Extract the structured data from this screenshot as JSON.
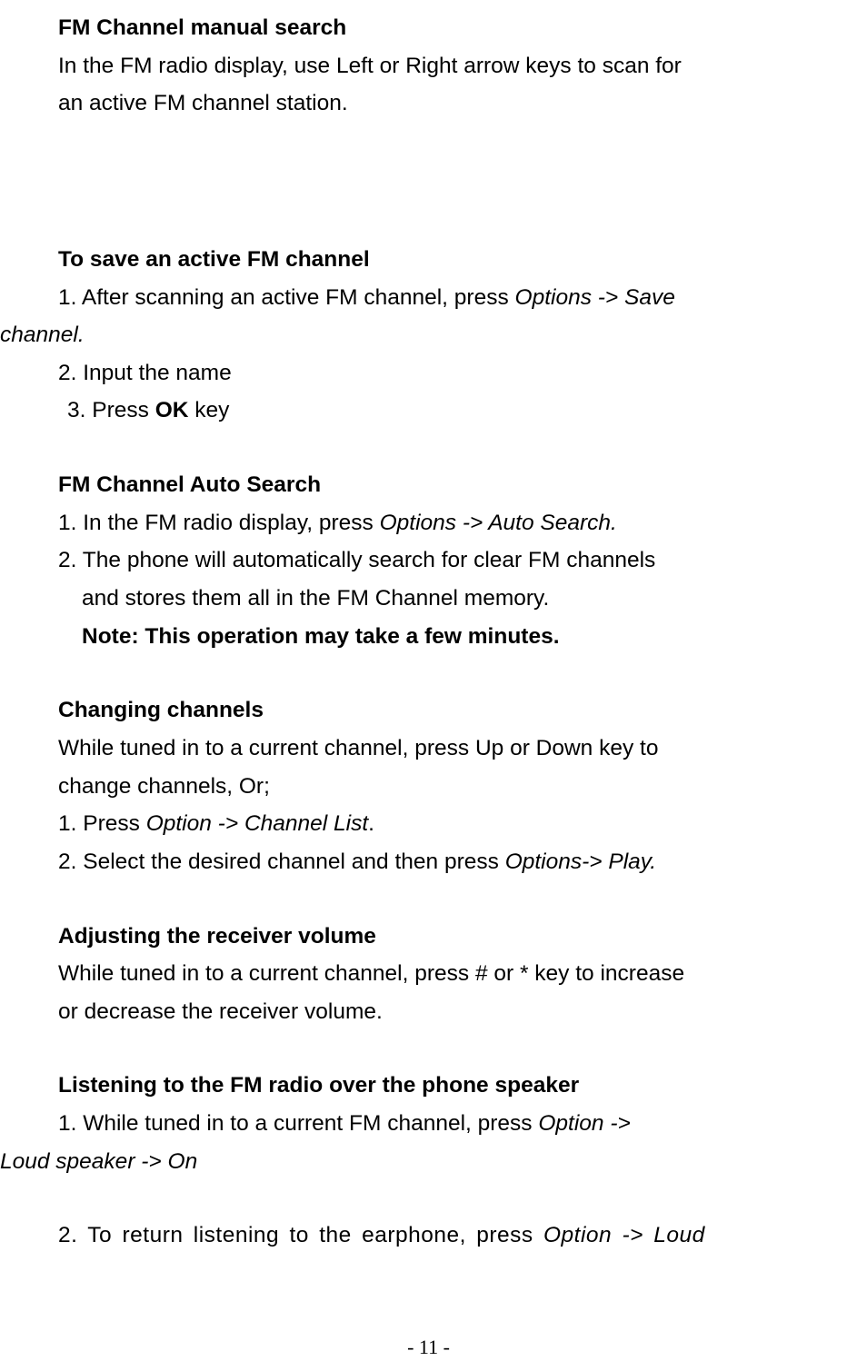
{
  "s1": {
    "title": "FM Channel manual search",
    "line1": "In the FM radio display, use Left or Right arrow keys to scan for",
    "line2": "an active FM channel station."
  },
  "s2": {
    "title": "To save an active FM channel",
    "line1a": "1. After scanning an active FM channel, press ",
    "line1b": "Options -> Save",
    "line1c": "channel.",
    "line2": "2. Input the name",
    "line3a": "3. Press ",
    "line3b": "OK",
    "line3c": " key"
  },
  "s3": {
    "title": "FM Channel Auto Search",
    "line1a": "1. In the FM radio display, press ",
    "line1b": "Options -> Auto Search.",
    "line2": "2. The phone will automatically search for clear FM channels",
    "line3": "and stores them all in the FM Channel memory.",
    "note": "Note: This operation may take a few minutes."
  },
  "s4": {
    "title": "Changing channels",
    "line1": "While tuned in to a current channel, press Up or Down key to",
    "line2": "change channels, Or;",
    "line3a": "1. Press ",
    "line3b": "Option -> Channel List",
    "line3c": ".",
    "line4a": "2. Select the desired channel and then press ",
    "line4b": "Options-> Play."
  },
  "s5": {
    "title": "Adjusting the receiver volume",
    "line1": "While tuned in to a current channel, press # or * key to increase",
    "line2": "or decrease the receiver volume."
  },
  "s6": {
    "title": "Listening to the FM radio over the phone speaker",
    "line1a": "1. While  tuned  in  to  a  current  FM  channel,  press ",
    "line1b": "Option  ->",
    "line1c": "Loud speaker -> On",
    "line2a": "2. To return listening to the earphone, press ",
    "line2b": "Option -> Loud"
  },
  "pagenum": "- 11 -"
}
